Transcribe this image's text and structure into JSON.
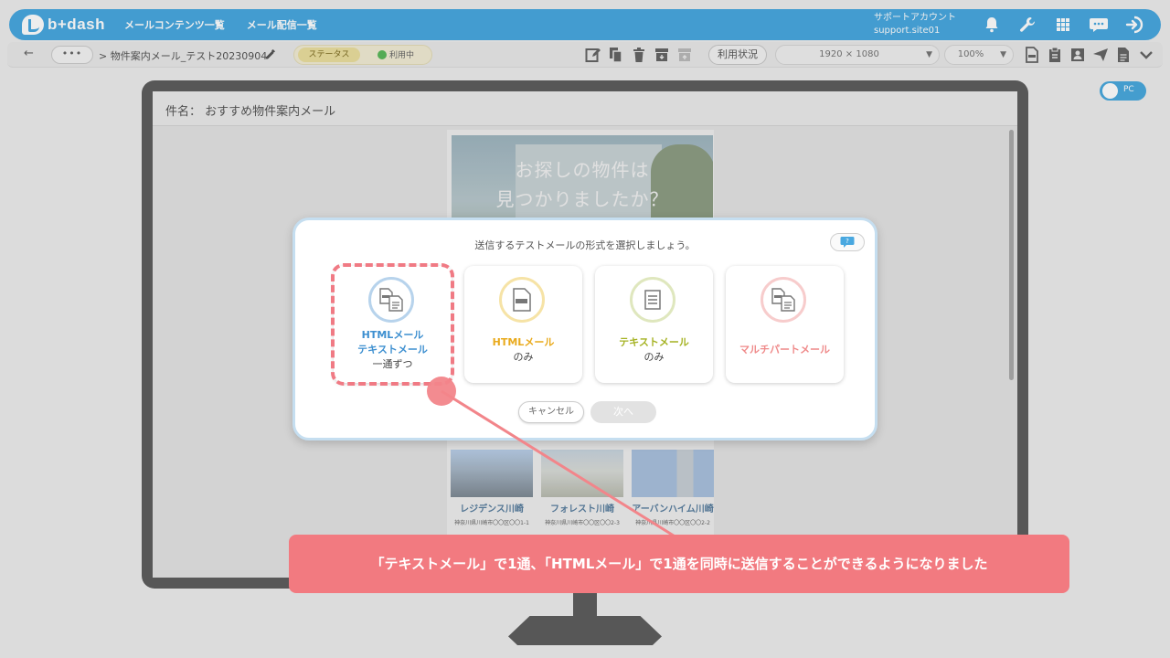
{
  "header": {
    "logo_text": "b+dash",
    "nav": [
      "メールコンテンツ一覧",
      "メール配信一覧"
    ],
    "account_name": "サポートアカウント",
    "account_id": "support.site01",
    "icons": [
      "bell-icon",
      "wrench-icon",
      "grid-icon",
      "chat-icon",
      "logout-icon"
    ]
  },
  "toolbar": {
    "more_label": "•••",
    "breadcrumb": "> 物件案内メール_テスト20230904",
    "status_label": "ステータス",
    "status_value": "利用中",
    "usage_label": "利用状況",
    "resolution_value": "1920 × 1080",
    "zoom_value": "100%"
  },
  "pc_toggle": {
    "label": "PC"
  },
  "preview": {
    "subject": "件名： おすすめ物件案内メール",
    "hero_line1": "お探しの物件は",
    "hero_line2": "見つかりましたか？",
    "properties": [
      {
        "name": "レジデンス川崎",
        "address": "神奈川県川崎市〇〇区〇〇1-1"
      },
      {
        "name": "フォレスト川崎",
        "address": "神奈川県川崎市〇〇区〇〇2-3"
      },
      {
        "name": "アーバンハイム川崎",
        "address": "神奈川県川崎市〇〇区〇〇2-2"
      }
    ]
  },
  "modal": {
    "title": "送信するテストメールの形式を選択しましょう。",
    "options": [
      {
        "line1": "HTMLメール",
        "line2": "テキストメール",
        "sub": "一通ずつ"
      },
      {
        "line1": "HTMLメール",
        "sub": "のみ"
      },
      {
        "line1": "テキストメール",
        "sub": "のみ"
      },
      {
        "line1": "マルチパートメール"
      }
    ],
    "cancel_label": "キャンセル",
    "next_label": "次へ"
  },
  "annotation": {
    "text": "「テキストメール」で1通、「HTMLメール」で1通を同時に送信することができるようになりました"
  },
  "colors": {
    "brand_blue": "#49a8e0",
    "callout_pink": "#f27a80",
    "html_text_blue": "#3d8fd0",
    "html_only_yellow": "#e9aa1c",
    "text_only_green": "#a6b324",
    "multipart_pink": "#ef8a8a"
  }
}
